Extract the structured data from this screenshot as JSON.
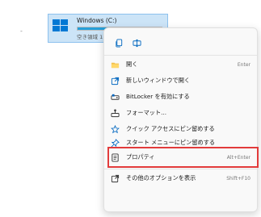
{
  "left_fragment": "-",
  "drive": {
    "name": "Windows (C:)",
    "free_label": "空き領域 1",
    "used_fraction": 0.52
  },
  "quick_actions": [
    {
      "icon": "copy-icon"
    },
    {
      "icon": "rename-icon"
    }
  ],
  "menu_items": [
    {
      "id": "open",
      "label": "開く",
      "shortcut": "Enter",
      "icon": "folder-icon"
    },
    {
      "id": "open-new-window",
      "label": "新しいウィンドウで開く",
      "shortcut": "",
      "icon": "open-new-window-icon"
    },
    {
      "id": "bitlocker",
      "label": "BitLocker を有効にする",
      "shortcut": "",
      "icon": "bitlocker-icon"
    },
    {
      "id": "format",
      "label": "フォーマット...",
      "shortcut": "",
      "icon": "format-icon"
    },
    {
      "id": "pin-quick-access",
      "label": "クイック アクセスにピン留めする",
      "shortcut": "",
      "icon": "star-pin-icon"
    },
    {
      "id": "pin-start",
      "label": "スタート メニューにピン留めする",
      "shortcut": "",
      "icon": "pin-icon"
    },
    {
      "id": "properties",
      "label": "プロパティ",
      "shortcut": "Alt+Enter",
      "icon": "properties-icon"
    },
    {
      "id": "more-options",
      "label": "その他のオプションを表示",
      "shortcut": "Shift+F10",
      "icon": "more-options-icon"
    }
  ],
  "colors": {
    "accent": "#0067c0",
    "highlight": "#e23b3b",
    "drive_selected_bg": "#cce4f7"
  }
}
